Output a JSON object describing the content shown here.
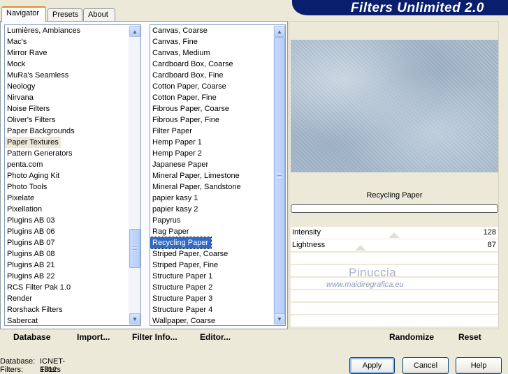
{
  "app": {
    "title": "Filters Unlimited 2.0"
  },
  "tabs": [
    {
      "label": "Navigator"
    },
    {
      "label": "Presets"
    },
    {
      "label": "About"
    }
  ],
  "categories": {
    "items": [
      "Lumières, Ambiances",
      "Mac's",
      "Mirror Rave",
      "Mock",
      "MuRa's Seamless",
      "Neology",
      "Nirvana",
      "Noise Filters",
      "Oliver's Filters",
      "Paper Backgrounds",
      "Paper Textures",
      "Pattern Generators",
      "penta.com",
      "Photo Aging Kit",
      "Photo Tools",
      "Pixelate",
      "Pixellation",
      "Plugins AB 03",
      "Plugins AB 06",
      "Plugins AB 07",
      "Plugins AB 08",
      "Plugins AB 21",
      "Plugins AB 22",
      "RCS Filter Pak 1.0",
      "Render",
      "Rorshack Filters",
      "Sabercat"
    ],
    "selected_index": 10,
    "scroll_position": 0.81
  },
  "filters": {
    "items": [
      "Canvas, Coarse",
      "Canvas, Fine",
      "Canvas, Medium",
      "Cardboard Box, Coarse",
      "Cardboard Box, Fine",
      "Cotton Paper, Coarse",
      "Cotton Paper, Fine",
      "Fibrous Paper, Coarse",
      "Fibrous Paper, Fine",
      "Filter Paper",
      "Hemp Paper 1",
      "Hemp Paper 2",
      "Japanese Paper",
      "Mineral Paper, Limestone",
      "Mineral Paper, Sandstone",
      "papier kasy 1",
      "papier kasy 2",
      "Papyrus",
      "Rag Paper",
      "Recycling Paper",
      "Striped Paper, Coarse",
      "Striped Paper, Fine",
      "Structure Paper 1",
      "Structure Paper 2",
      "Structure Paper 3",
      "Structure Paper 4",
      "Wallpaper, Coarse"
    ],
    "selected_index": 19
  },
  "left_buttons": {
    "database": "Database",
    "import": "Import...",
    "filter_info": "Filter Info...",
    "editor": "Editor..."
  },
  "right": {
    "filter_name": "Recycling Paper",
    "params": [
      {
        "label": "Intensity",
        "value": "128"
      },
      {
        "label": "Lightness",
        "value": "87"
      }
    ],
    "randomize": "Randomize",
    "reset": "Reset"
  },
  "watermark": {
    "name": "Pinuccia",
    "site": "www.maidiregrafica.eu"
  },
  "status": {
    "database_label": "Database:",
    "database_value": "ICNET-Filters",
    "filters_label": "Filters:",
    "filters_value": "1312"
  },
  "dialog_buttons": {
    "apply": "Apply",
    "cancel": "Cancel",
    "help": "Help"
  },
  "colors": {
    "banner": "#0a1e6e",
    "selection": "#316ac5",
    "face": "#ece9d8"
  }
}
